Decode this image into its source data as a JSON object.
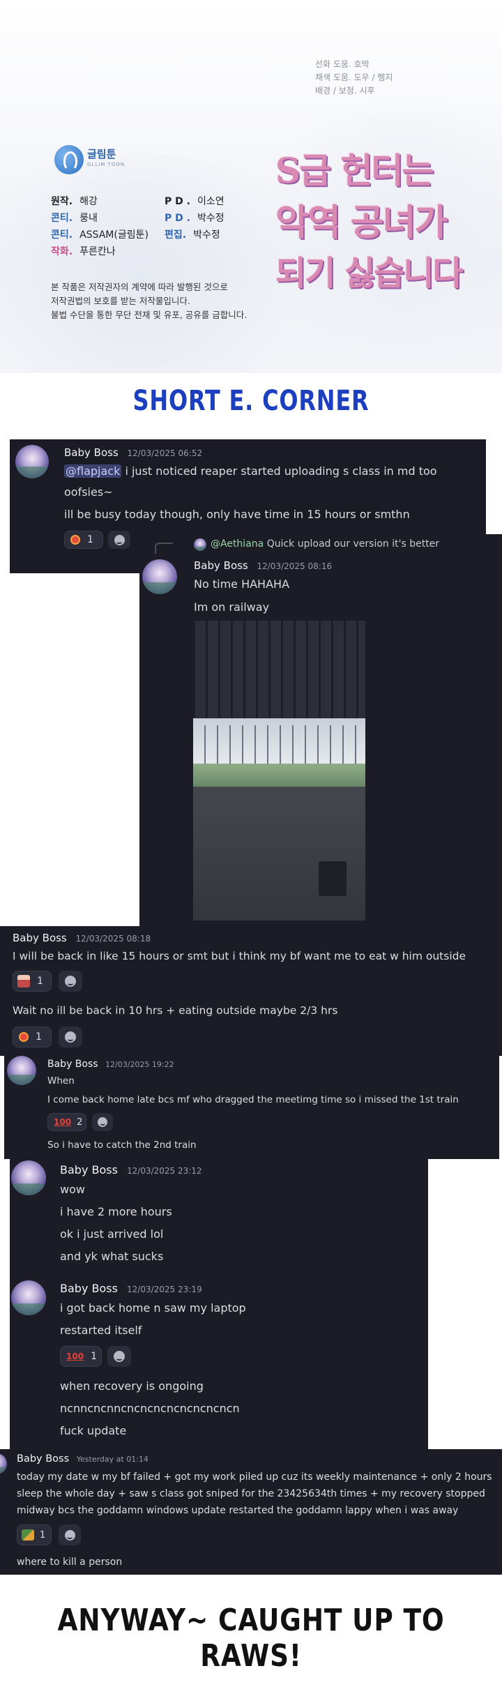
{
  "credits": {
    "artist_credits": [
      "선화 도움. 호박",
      "채색 도움. 도우 / 펭지",
      "배경 / 보정. 시후"
    ],
    "logo": {
      "name": "글림툰",
      "sub": "GLLIM TOON"
    },
    "roles": [
      {
        "label": "원작.",
        "value": "해강",
        "color": "#222222"
      },
      {
        "label": "콘티.",
        "value": "룽내",
        "color": "#2f66b0"
      },
      {
        "label": "콘티.",
        "value": "ASSAM(글림툰)",
        "color": "#2f66b0"
      },
      {
        "label": "작화.",
        "value": "푸른칸나",
        "color": "#c4508b"
      }
    ],
    "pd_roles": [
      {
        "label": "P D .",
        "value": "이소연",
        "color": "#222222"
      },
      {
        "label": "P D .",
        "value": "박수정",
        "color": "#2f66b0"
      },
      {
        "label": "편집.",
        "value": "박수정",
        "color": "#2f66b0"
      }
    ],
    "copyright": [
      "본 작품은 저작권자의 계약에 따라 발행된 것으로",
      "저작권법의 보호를 받는 저작물입니다.",
      "불법 수단을 통한 무단 전재 및 유포, 공유를 금합니다."
    ],
    "title_lines": [
      "S급 헌터는",
      "악역 공녀가",
      "되기 싫습니다"
    ]
  },
  "banner_top": "SHORT E. CORNER",
  "banner_bottom": "ANYWAY~ CAUGHT UP TO RAWS!",
  "chat1": {
    "username": "Baby Boss",
    "timestamp": "12/03/2025 06:52",
    "mention": "@flapjack",
    "line1_rest": "i just noticed reaper started uploading s class in md too",
    "line2": "oofsies~",
    "line3": "ill be busy today though, only have time in 15 hours or smthn",
    "reaction_count": "1",
    "reaction_emoji": "alarm-clock"
  },
  "chat2": {
    "reply_name": "@Aethiana",
    "reply_text": "Quick upload our version it's better",
    "username": "Baby Boss",
    "timestamp": "12/03/2025 08:16",
    "line1": "No time HAHAHA",
    "line2": "Im on railway"
  },
  "chat3": {
    "username": "Baby Boss",
    "timestamp": "12/03/2025 08:18",
    "line1": "I will be back in like 15 hours or smt but i think my bf want me to eat w him outside",
    "reaction1_count": "1",
    "line2": "Wait no ill be back in 10 hrs + eating outside maybe 2/3 hrs",
    "reaction2_count": "1"
  },
  "chat4": {
    "username": "Baby Boss",
    "timestamp": "12/03/2025 19:22",
    "line1": "When",
    "line2": "I come back home late bcs mf who dragged the meetimg time so i missed the 1st train",
    "reaction_count": "2",
    "line3": "So i have to catch the 2nd train"
  },
  "chat5": {
    "username": "Baby Boss",
    "timestamp": "12/03/2025 23:12",
    "lines": [
      "wow",
      "i have 2 more hours",
      "ok i just arrived lol",
      "and yk what sucks"
    ]
  },
  "chat6": {
    "username": "Baby Boss",
    "timestamp": "12/03/2025 23:19",
    "line1": "i got back home n saw my laptop",
    "line2": "restarted itself",
    "reaction_count": "1",
    "line3": "when recovery is ongoing",
    "line4": "ncnncncnncncncncncncncncncn",
    "line5": "fuck update"
  },
  "chat7": {
    "username": "Baby Boss",
    "timestamp": "Yesterday at 01:14",
    "line1": "today my date w my bf failed + got my work piled up cuz its weekly maintenance + only 2 hours",
    "line2": "sleep the whole day + saw s class got sniped for the 23425634th times + my recovery stopped",
    "line3": "midway bcs the goddamn windows update restarted the goddamn lappy when i was away",
    "reaction_count": "1",
    "line4": "where to kill a person"
  },
  "colors": {
    "panel_bg": "#1b1b25",
    "banner_blue": "#1c3fbf",
    "mention_bg": "#3c4270"
  }
}
